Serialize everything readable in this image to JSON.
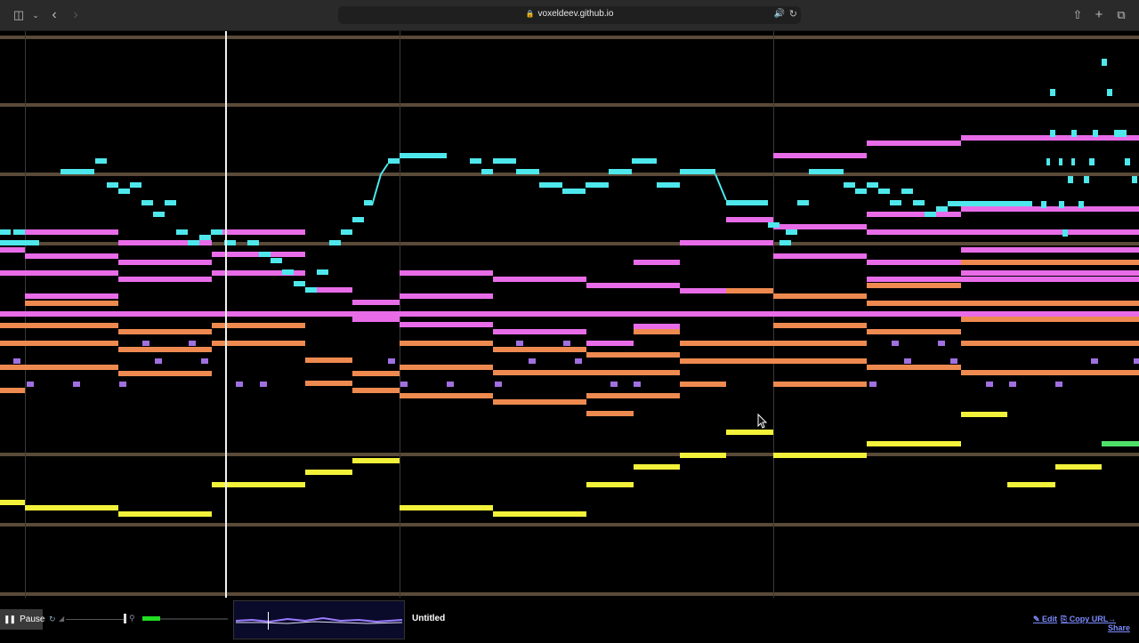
{
  "browser": {
    "url": "voxeldeev.github.io",
    "icons": {
      "sidebar": "sidebar-icon",
      "chevron": "chevron-down-icon",
      "back": "back-icon",
      "forward": "forward-icon",
      "lock": "lock-icon",
      "audio": "speaker-icon",
      "reload": "reload-icon",
      "share": "share-icon",
      "new_tab": "plus-icon",
      "tabs": "tabs-icon"
    }
  },
  "colors": {
    "background": "#000000",
    "row_line": "#5a4a38",
    "measure_line": "#3a3a3a",
    "playhead": "#f2f2f2",
    "cyan": "#4ee8ec",
    "pink": "#e86ce8",
    "orange": "#ee8a50",
    "purple": "#a070e0",
    "yellow": "#f2f23a",
    "green": "#4fe06a",
    "link": "#7c8cff"
  },
  "visualizer": {
    "playhead_progress": 0.198,
    "notes": {
      "cyan": [
        [
          68,
          190,
          106,
          196
        ],
        [
          107,
          178,
          120,
          184
        ],
        [
          120,
          205,
          133,
          211
        ],
        [
          133,
          212,
          146,
          218
        ],
        [
          146,
          205,
          159,
          211
        ],
        [
          159,
          225,
          172,
          231
        ],
        [
          172,
          238,
          185,
          244
        ],
        [
          185,
          225,
          198,
          231
        ],
        [
          198,
          258,
          211,
          264
        ],
        [
          211,
          270,
          224,
          276
        ],
        [
          224,
          264,
          237,
          270
        ],
        [
          237,
          258,
          250,
          264
        ],
        [
          252,
          270,
          265,
          276
        ],
        [
          278,
          270,
          291,
          276
        ],
        [
          291,
          283,
          304,
          289
        ],
        [
          304,
          290,
          317,
          296
        ],
        [
          317,
          303,
          330,
          309
        ],
        [
          330,
          316,
          343,
          322
        ],
        [
          343,
          323,
          356,
          329
        ],
        [
          356,
          303,
          369,
          309
        ],
        [
          370,
          270,
          383,
          276
        ],
        [
          383,
          258,
          396,
          264
        ],
        [
          396,
          244,
          409,
          250
        ],
        [
          409,
          225,
          418,
          231
        ],
        [
          436,
          178,
          449,
          184
        ],
        [
          449,
          172,
          502,
          178
        ],
        [
          528,
          178,
          541,
          184
        ],
        [
          541,
          190,
          554,
          196
        ],
        [
          554,
          178,
          580,
          184
        ],
        [
          580,
          190,
          606,
          196
        ],
        [
          606,
          205,
          632,
          211
        ],
        [
          632,
          212,
          658,
          218
        ],
        [
          658,
          205,
          684,
          211
        ],
        [
          684,
          190,
          710,
          196
        ],
        [
          710,
          178,
          738,
          184
        ],
        [
          738,
          205,
          764,
          211
        ],
        [
          764,
          190,
          804,
          196
        ],
        [
          816,
          225,
          863,
          231
        ],
        [
          863,
          250,
          876,
          256
        ],
        [
          876,
          270,
          889,
          276
        ],
        [
          883,
          258,
          896,
          264
        ],
        [
          896,
          225,
          909,
          231
        ],
        [
          909,
          190,
          948,
          196
        ],
        [
          948,
          205,
          961,
          211
        ],
        [
          961,
          212,
          974,
          218
        ],
        [
          974,
          205,
          987,
          211
        ],
        [
          987,
          212,
          1000,
          218
        ],
        [
          1000,
          225,
          1013,
          231
        ],
        [
          1013,
          212,
          1026,
          218
        ],
        [
          1026,
          225,
          1039,
          231
        ],
        [
          1039,
          238,
          1052,
          244
        ],
        [
          1052,
          232,
          1065,
          238
        ],
        [
          1065,
          226,
          1160,
          232
        ],
        [
          1238,
          66,
          1244,
          74
        ],
        [
          1244,
          100,
          1250,
          108
        ],
        [
          1180,
          146,
          1186,
          154
        ],
        [
          1204,
          146,
          1210,
          154
        ],
        [
          1228,
          146,
          1234,
          154
        ],
        [
          1252,
          146,
          1266,
          154
        ],
        [
          1176,
          178,
          1180,
          186
        ],
        [
          1190,
          178,
          1194,
          186
        ],
        [
          1204,
          178,
          1208,
          186
        ],
        [
          1224,
          178,
          1230,
          186
        ],
        [
          1264,
          178,
          1270,
          186
        ],
        [
          1200,
          198,
          1206,
          206
        ],
        [
          1218,
          198,
          1224,
          206
        ],
        [
          1272,
          198,
          1278,
          206
        ],
        [
          1170,
          226,
          1176,
          234
        ],
        [
          1190,
          226,
          1196,
          234
        ],
        [
          1212,
          226,
          1218,
          234
        ],
        [
          1194,
          258,
          1200,
          266
        ],
        [
          0,
          258,
          12,
          264
        ],
        [
          15,
          258,
          28,
          264
        ],
        [
          0,
          270,
          44,
          276
        ],
        [
          1180,
          100,
          1186,
          108
        ]
      ],
      "cyan_lines": [
        [
          418,
          231,
          428,
          196,
          436,
          184
        ],
        [
          804,
          196,
          816,
          225
        ]
      ],
      "pink": [
        [
          28,
          258,
          133,
          264
        ],
        [
          0,
          278,
          28,
          284
        ],
        [
          28,
          285,
          133,
          291
        ],
        [
          133,
          270,
          238,
          276
        ],
        [
          133,
          292,
          238,
          298
        ],
        [
          238,
          258,
          343,
          264
        ],
        [
          238,
          283,
          343,
          289
        ],
        [
          0,
          304,
          133,
          310
        ],
        [
          133,
          311,
          238,
          317
        ],
        [
          238,
          304,
          343,
          310
        ],
        [
          28,
          330,
          133,
          336
        ],
        [
          343,
          323,
          396,
          329
        ],
        [
          396,
          337,
          449,
          343
        ],
        [
          396,
          356,
          449,
          362
        ],
        [
          449,
          304,
          554,
          310
        ],
        [
          449,
          330,
          554,
          336
        ],
        [
          554,
          311,
          659,
          317
        ],
        [
          659,
          318,
          764,
          324
        ],
        [
          659,
          383,
          712,
          389
        ],
        [
          554,
          370,
          659,
          376
        ],
        [
          449,
          362,
          554,
          368
        ],
        [
          712,
          292,
          764,
          298
        ],
        [
          712,
          364,
          764,
          370
        ],
        [
          764,
          270,
          869,
          276
        ],
        [
          764,
          324,
          816,
          330
        ],
        [
          816,
          244,
          869,
          250
        ],
        [
          869,
          172,
          974,
          178
        ],
        [
          869,
          252,
          974,
          258
        ],
        [
          869,
          285,
          974,
          291
        ],
        [
          974,
          158,
          1080,
          164
        ],
        [
          974,
          238,
          1080,
          244
        ],
        [
          974,
          258,
          1080,
          264
        ],
        [
          974,
          292,
          1080,
          298
        ],
        [
          974,
          311,
          1080,
          317
        ],
        [
          1080,
          152,
          1280,
          158
        ],
        [
          1080,
          232,
          1280,
          238
        ],
        [
          1080,
          258,
          1280,
          264
        ],
        [
          1080,
          278,
          1280,
          284
        ],
        [
          1080,
          304,
          1280,
          310
        ],
        [
          1080,
          311,
          1280,
          317
        ],
        [
          0,
          350,
          1280,
          356
        ]
      ],
      "orange": [
        [
          28,
          338,
          133,
          344
        ],
        [
          0,
          363,
          28,
          369
        ],
        [
          28,
          363,
          133,
          369
        ],
        [
          133,
          370,
          238,
          376
        ],
        [
          238,
          363,
          343,
          369
        ],
        [
          0,
          383,
          133,
          389
        ],
        [
          133,
          390,
          238,
          396
        ],
        [
          238,
          383,
          343,
          389
        ],
        [
          0,
          410,
          28,
          416
        ],
        [
          28,
          410,
          133,
          416
        ],
        [
          133,
          417,
          238,
          423
        ],
        [
          0,
          436,
          28,
          442
        ],
        [
          343,
          402,
          396,
          408
        ],
        [
          343,
          428,
          396,
          434
        ],
        [
          396,
          417,
          449,
          423
        ],
        [
          396,
          436,
          449,
          442
        ],
        [
          449,
          383,
          554,
          389
        ],
        [
          449,
          410,
          554,
          416
        ],
        [
          449,
          442,
          554,
          448
        ],
        [
          554,
          390,
          659,
          396
        ],
        [
          554,
          416,
          659,
          422
        ],
        [
          554,
          449,
          659,
          455
        ],
        [
          659,
          396,
          764,
          402
        ],
        [
          659,
          416,
          764,
          422
        ],
        [
          659,
          442,
          764,
          448
        ],
        [
          659,
          462,
          712,
          468
        ],
        [
          712,
          370,
          764,
          376
        ],
        [
          764,
          383,
          869,
          389
        ],
        [
          764,
          403,
          869,
          409
        ],
        [
          764,
          429,
          816,
          435
        ],
        [
          816,
          324,
          869,
          330
        ],
        [
          869,
          330,
          974,
          336
        ],
        [
          869,
          363,
          974,
          369
        ],
        [
          869,
          383,
          974,
          389
        ],
        [
          869,
          403,
          974,
          409
        ],
        [
          869,
          429,
          974,
          435
        ],
        [
          974,
          318,
          1080,
          324
        ],
        [
          974,
          338,
          1080,
          344
        ],
        [
          974,
          370,
          1080,
          376
        ],
        [
          974,
          410,
          1080,
          416
        ],
        [
          1080,
          304,
          1280,
          310
        ],
        [
          1080,
          292,
          1280,
          298
        ],
        [
          1080,
          338,
          1280,
          344
        ],
        [
          1080,
          356,
          1280,
          362
        ],
        [
          1080,
          383,
          1280,
          389
        ],
        [
          1080,
          416,
          1280,
          422
        ]
      ],
      "purple": [
        [
          15,
          403,
          23,
          409
        ],
        [
          30,
          429,
          38,
          435
        ],
        [
          82,
          429,
          90,
          435
        ],
        [
          134,
          429,
          142,
          435
        ],
        [
          160,
          383,
          168,
          389
        ],
        [
          174,
          403,
          182,
          409
        ],
        [
          212,
          383,
          220,
          389
        ],
        [
          226,
          403,
          234,
          409
        ],
        [
          265,
          429,
          273,
          435
        ],
        [
          292,
          429,
          300,
          435
        ],
        [
          436,
          403,
          444,
          409
        ],
        [
          450,
          429,
          458,
          435
        ],
        [
          502,
          429,
          510,
          435
        ],
        [
          556,
          429,
          564,
          435
        ],
        [
          580,
          383,
          588,
          389
        ],
        [
          594,
          403,
          602,
          409
        ],
        [
          633,
          383,
          641,
          389
        ],
        [
          646,
          403,
          654,
          409
        ],
        [
          686,
          429,
          694,
          435
        ],
        [
          712,
          429,
          720,
          435
        ],
        [
          977,
          429,
          985,
          435
        ],
        [
          1002,
          383,
          1010,
          389
        ],
        [
          1016,
          403,
          1024,
          409
        ],
        [
          1054,
          383,
          1062,
          389
        ],
        [
          1068,
          403,
          1076,
          409
        ],
        [
          1108,
          429,
          1116,
          435
        ],
        [
          1134,
          429,
          1142,
          435
        ],
        [
          1186,
          429,
          1194,
          435
        ],
        [
          1226,
          403,
          1234,
          409
        ],
        [
          1274,
          403,
          1280,
          409
        ]
      ],
      "yellow": [
        [
          0,
          562,
          28,
          568
        ],
        [
          28,
          568,
          133,
          574
        ],
        [
          133,
          575,
          238,
          581
        ],
        [
          238,
          542,
          343,
          548
        ],
        [
          343,
          528,
          396,
          534
        ],
        [
          396,
          515,
          449,
          521
        ],
        [
          449,
          568,
          554,
          574
        ],
        [
          554,
          575,
          659,
          581
        ],
        [
          659,
          542,
          712,
          548
        ],
        [
          712,
          522,
          764,
          528
        ],
        [
          764,
          509,
          816,
          515
        ],
        [
          816,
          483,
          869,
          489
        ],
        [
          869,
          509,
          974,
          515
        ],
        [
          974,
          496,
          1080,
          502
        ],
        [
          1080,
          463,
          1132,
          469
        ],
        [
          1132,
          542,
          1186,
          548
        ],
        [
          1186,
          522,
          1238,
          528
        ]
      ],
      "green": [
        [
          8,
          270,
          30,
          276
        ],
        [
          1238,
          496,
          1280,
          502
        ]
      ]
    }
  },
  "toolbar": {
    "pause_label": "Pause",
    "song_title": "Untitled",
    "edit_label": "✎ Edit",
    "copy_url_label": "⎘ Copy URL",
    "share_label": "→ Share",
    "volume_level": 0.2,
    "seek_progress": 0.97,
    "icons": {
      "pause": "pause-icon",
      "loop": "loop-icon",
      "volume": "volume-icon",
      "zoom": "zoom-icon"
    }
  }
}
